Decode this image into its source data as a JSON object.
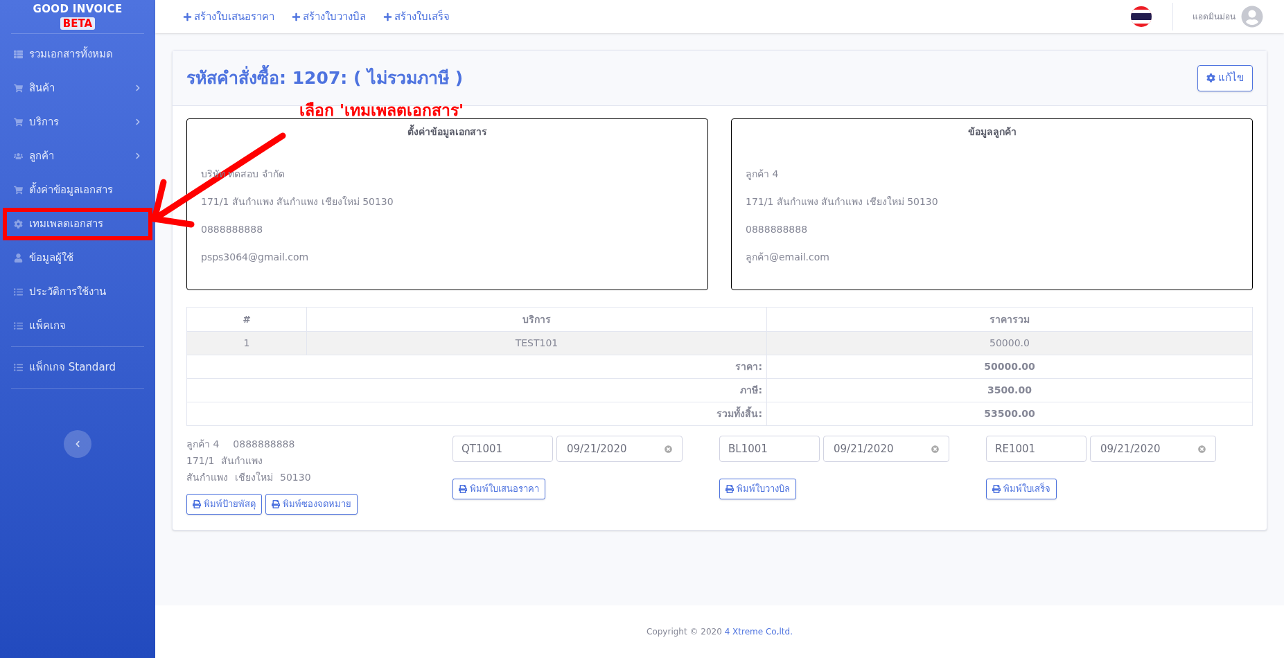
{
  "brand": {
    "title": "GOOD INVOICE",
    "badge": "BETA"
  },
  "sidebar": {
    "sections": [
      [
        {
          "label": "รวมเอกสารทั้งหมด",
          "expandable": false,
          "highlighted": false
        },
        {
          "label": "สินค้า",
          "expandable": true,
          "highlighted": false
        },
        {
          "label": "บริการ",
          "expandable": true,
          "highlighted": false
        },
        {
          "label": "ลูกค้า",
          "expandable": true,
          "highlighted": false
        },
        {
          "label": "ตั้งค่าข้อมูลเอกสาร",
          "expandable": false,
          "highlighted": false
        },
        {
          "label": "เทมเพลตเอกสาร",
          "expandable": false,
          "highlighted": true
        },
        {
          "label": "ข้อมูลผู้ใช้",
          "expandable": false,
          "highlighted": false
        },
        {
          "label": "ประวัติการใช้งาน",
          "expandable": false,
          "highlighted": false
        },
        {
          "label": "แพ็คเกจ",
          "expandable": false,
          "highlighted": false
        }
      ],
      [
        {
          "label": "แพ็กเกจ Standard",
          "expandable": false,
          "highlighted": false
        }
      ]
    ]
  },
  "topbar": {
    "links": [
      "สร้างใบเสนอราคา",
      "สร้างใบวางบิล",
      "สร้างใบเสร็จ"
    ],
    "user": "แอดมินม่อน"
  },
  "card": {
    "title": "รหัสคำสั่งซื้อ: 1207: ( ไม่รวมภาษี )",
    "edit_button": "แก้ไข"
  },
  "annotation": {
    "text": "เลือก 'เทมเพลตเอกสาร'"
  },
  "info_boxes": [
    {
      "heading": "ตั้งค่าข้อมูลเอกสาร",
      "lines": [
        "บริษัท ทดสอบ จำกัด",
        "171/1 สันกำแพง สันกำแพง เชียงใหม่ 50130",
        "0888888888",
        "psps3064@gmail.com"
      ]
    },
    {
      "heading": "ข้อมูลลูกค้า",
      "lines": [
        "ลูกค้า 4",
        "171/1 สันกำแพง สันกำแพง เชียงใหม่ 50130",
        "0888888888",
        "ลูกค้า@email.com"
      ]
    }
  ],
  "table": {
    "columns": [
      "#",
      "บริการ",
      "ราคารวม"
    ],
    "rows": [
      [
        "1",
        "TEST101",
        "50000.0"
      ]
    ],
    "summary": [
      {
        "label": "ราคา:",
        "value": "50000.00"
      },
      {
        "label": "ภาษี:",
        "value": "3500.00"
      },
      {
        "label": "รวมทั้งสิ้น:",
        "value": "53500.00"
      }
    ]
  },
  "shipping": {
    "lines": [
      [
        "ลูกค้า 4",
        "0888888888"
      ],
      [
        "171/1",
        "สันกำแพง"
      ],
      [
        "สันกำแพง",
        "เชียงใหม่",
        "50130"
      ]
    ],
    "buttons": [
      "พิมพ์ป้ายพัสดุ",
      "พิมพ์ซองจดหมาย"
    ]
  },
  "documents": [
    {
      "number": "QT1001",
      "date": "09/21/2020",
      "button": "พิมพ์ใบเสนอราคา"
    },
    {
      "number": "BL1001",
      "date": "09/21/2020",
      "button": "พิมพ์ใบวางบิล"
    },
    {
      "number": "RE1001",
      "date": "09/21/2020",
      "button": "พิมพ์ใบเสร็จ"
    }
  ],
  "footer": {
    "text": "Copyright © 2020",
    "link": "4 Xtreme Co,ltd."
  }
}
